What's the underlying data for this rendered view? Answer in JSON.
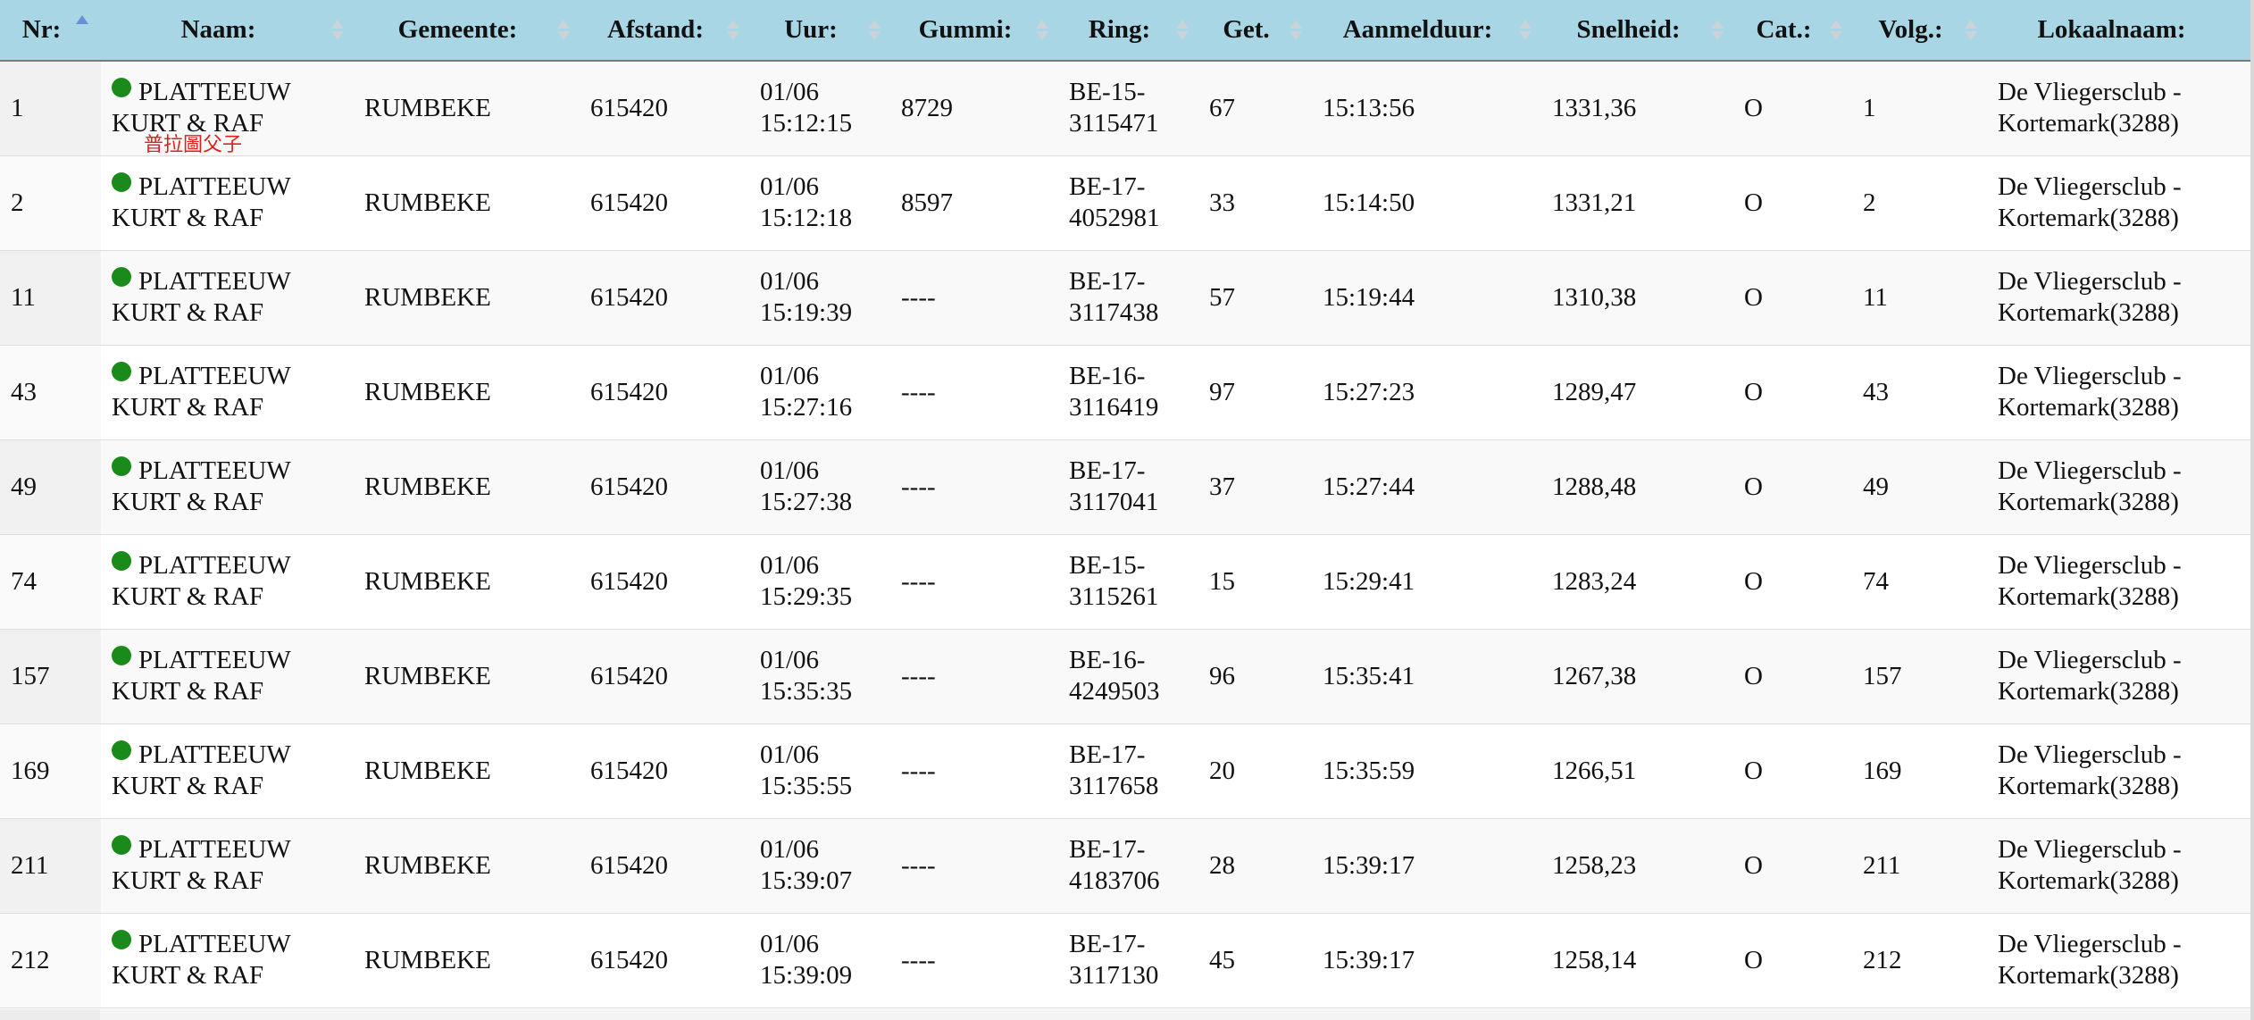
{
  "columns": [
    {
      "label": "Nr:",
      "sort": "asc"
    },
    {
      "label": "Naam:",
      "sort": "none"
    },
    {
      "label": "Gemeente:",
      "sort": "none"
    },
    {
      "label": "Afstand:",
      "sort": "none"
    },
    {
      "label": "Uur:",
      "sort": "none"
    },
    {
      "label": "Gummi:",
      "sort": "none"
    },
    {
      "label": "Ring:",
      "sort": "none"
    },
    {
      "label": "Get.",
      "sort": "none"
    },
    {
      "label": "Aanmelduur:",
      "sort": "none"
    },
    {
      "label": "Snelheid:",
      "sort": "none"
    },
    {
      "label": "Cat.:",
      "sort": "none"
    },
    {
      "label": "Volg.:",
      "sort": "none"
    },
    {
      "label": "Lokaalnaam:",
      "sort": "none"
    }
  ],
  "rows": [
    {
      "nr": "1",
      "naam_line1": "PLATTEEUW",
      "naam_line2": "KURT & RAF",
      "note": "普拉圖父子",
      "gemeente": "RUMBEKE",
      "afstand": "615420",
      "uur_date": "01/06",
      "uur_time": "15:12:15",
      "gummi": "8729",
      "ring_line1": "BE-15-",
      "ring_line2": "3115471",
      "get": "67",
      "aanmelduur": "15:13:56",
      "snelheid": "1331,36",
      "cat": "O",
      "volg": "1",
      "lokaal_line1": "De Vliegersclub -",
      "lokaal_line2": "Kortemark(3288)"
    },
    {
      "nr": "2",
      "naam_line1": "PLATTEEUW",
      "naam_line2": "KURT & RAF",
      "gemeente": "RUMBEKE",
      "afstand": "615420",
      "uur_date": "01/06",
      "uur_time": "15:12:18",
      "gummi": "8597",
      "ring_line1": "BE-17-",
      "ring_line2": "4052981",
      "get": "33",
      "aanmelduur": "15:14:50",
      "snelheid": "1331,21",
      "cat": "O",
      "volg": "2",
      "lokaal_line1": "De Vliegersclub -",
      "lokaal_line2": "Kortemark(3288)"
    },
    {
      "nr": "11",
      "naam_line1": "PLATTEEUW",
      "naam_line2": "KURT & RAF",
      "gemeente": "RUMBEKE",
      "afstand": "615420",
      "uur_date": "01/06",
      "uur_time": "15:19:39",
      "gummi": "----",
      "ring_line1": "BE-17-",
      "ring_line2": "3117438",
      "get": "57",
      "aanmelduur": "15:19:44",
      "snelheid": "1310,38",
      "cat": "O",
      "volg": "11",
      "lokaal_line1": "De Vliegersclub -",
      "lokaal_line2": "Kortemark(3288)"
    },
    {
      "nr": "43",
      "naam_line1": "PLATTEEUW",
      "naam_line2": "KURT & RAF",
      "gemeente": "RUMBEKE",
      "afstand": "615420",
      "uur_date": "01/06",
      "uur_time": "15:27:16",
      "gummi": "----",
      "ring_line1": "BE-16-",
      "ring_line2": "3116419",
      "get": "97",
      "aanmelduur": "15:27:23",
      "snelheid": "1289,47",
      "cat": "O",
      "volg": "43",
      "lokaal_line1": "De Vliegersclub -",
      "lokaal_line2": "Kortemark(3288)"
    },
    {
      "nr": "49",
      "naam_line1": "PLATTEEUW",
      "naam_line2": "KURT & RAF",
      "gemeente": "RUMBEKE",
      "afstand": "615420",
      "uur_date": "01/06",
      "uur_time": "15:27:38",
      "gummi": "----",
      "ring_line1": "BE-17-",
      "ring_line2": "3117041",
      "get": "37",
      "aanmelduur": "15:27:44",
      "snelheid": "1288,48",
      "cat": "O",
      "volg": "49",
      "lokaal_line1": "De Vliegersclub -",
      "lokaal_line2": "Kortemark(3288)"
    },
    {
      "nr": "74",
      "naam_line1": "PLATTEEUW",
      "naam_line2": "KURT & RAF",
      "gemeente": "RUMBEKE",
      "afstand": "615420",
      "uur_date": "01/06",
      "uur_time": "15:29:35",
      "gummi": "----",
      "ring_line1": "BE-15-",
      "ring_line2": "3115261",
      "get": "15",
      "aanmelduur": "15:29:41",
      "snelheid": "1283,24",
      "cat": "O",
      "volg": "74",
      "lokaal_line1": "De Vliegersclub -",
      "lokaal_line2": "Kortemark(3288)"
    },
    {
      "nr": "157",
      "naam_line1": "PLATTEEUW",
      "naam_line2": "KURT & RAF",
      "gemeente": "RUMBEKE",
      "afstand": "615420",
      "uur_date": "01/06",
      "uur_time": "15:35:35",
      "gummi": "----",
      "ring_line1": "BE-16-",
      "ring_line2": "4249503",
      "get": "96",
      "aanmelduur": "15:35:41",
      "snelheid": "1267,38",
      "cat": "O",
      "volg": "157",
      "lokaal_line1": "De Vliegersclub -",
      "lokaal_line2": "Kortemark(3288)"
    },
    {
      "nr": "169",
      "naam_line1": "PLATTEEUW",
      "naam_line2": "KURT & RAF",
      "gemeente": "RUMBEKE",
      "afstand": "615420",
      "uur_date": "01/06",
      "uur_time": "15:35:55",
      "gummi": "----",
      "ring_line1": "BE-17-",
      "ring_line2": "3117658",
      "get": "20",
      "aanmelduur": "15:35:59",
      "snelheid": "1266,51",
      "cat": "O",
      "volg": "169",
      "lokaal_line1": "De Vliegersclub -",
      "lokaal_line2": "Kortemark(3288)"
    },
    {
      "nr": "211",
      "naam_line1": "PLATTEEUW",
      "naam_line2": "KURT & RAF",
      "gemeente": "RUMBEKE",
      "afstand": "615420",
      "uur_date": "01/06",
      "uur_time": "15:39:07",
      "gummi": "----",
      "ring_line1": "BE-17-",
      "ring_line2": "4183706",
      "get": "28",
      "aanmelduur": "15:39:17",
      "snelheid": "1258,23",
      "cat": "O",
      "volg": "211",
      "lokaal_line1": "De Vliegersclub -",
      "lokaal_line2": "Kortemark(3288)"
    },
    {
      "nr": "212",
      "naam_line1": "PLATTEEUW",
      "naam_line2": "KURT & RAF",
      "gemeente": "RUMBEKE",
      "afstand": "615420",
      "uur_date": "01/06",
      "uur_time": "15:39:09",
      "gummi": "----",
      "ring_line1": "BE-17-",
      "ring_line2": "3117130",
      "get": "45",
      "aanmelduur": "15:39:17",
      "snelheid": "1258,14",
      "cat": "O",
      "volg": "212",
      "lokaal_line1": "De Vliegersclub -",
      "lokaal_line2": "Kortemark(3288)"
    }
  ],
  "colors": {
    "header_bg": "#a8d6e5",
    "status_dot": "#1a8a1a",
    "note_text": "#e0201e",
    "sort_active": "#6a8fd8"
  },
  "icons": {
    "status": "green-circle-icon",
    "sort": "sort-arrows-icon",
    "sort_active": "sort-ascending-icon"
  }
}
